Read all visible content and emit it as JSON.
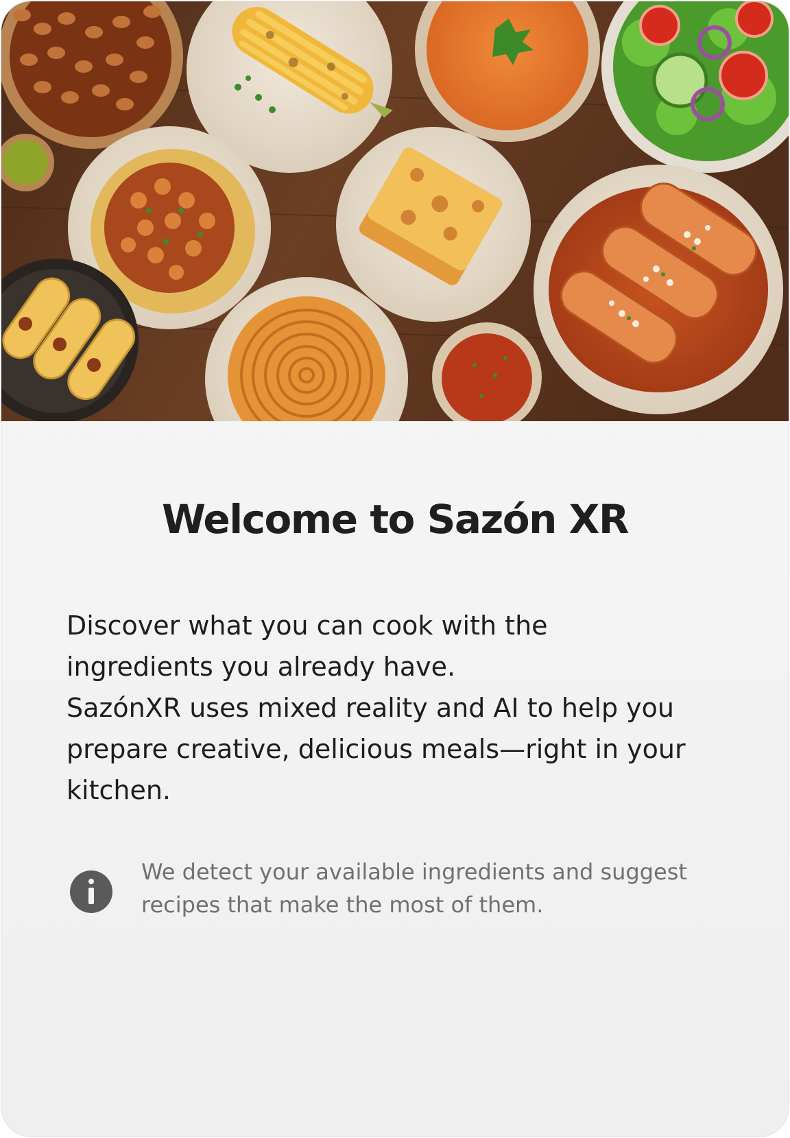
{
  "hero": {
    "image_subject": "overhead photo of Mexican dishes on a wooden table: beans, grilled corn, tomato soup, salad, chickpea tostada, lasagna, enchiladas, spaghetti, salsa, tacos",
    "colors": {
      "table": "#5a3420",
      "plate": "#e9dfd0",
      "sauce": "#b8461c",
      "cheese": "#f2b84a"
    }
  },
  "welcome": {
    "title": "Welcome to Sazón XR",
    "description_lines": [
      "Discover what you can cook with the",
      "ingredients you already have.",
      "SazónXR uses mixed reality and AI to help you",
      "prepare creative, delicious meals—right in your",
      "kitchen."
    ]
  },
  "info": {
    "icon": "info-icon",
    "lines": [
      "We detect your available ingredients and suggest",
      "recipes that make the most of them."
    ]
  }
}
